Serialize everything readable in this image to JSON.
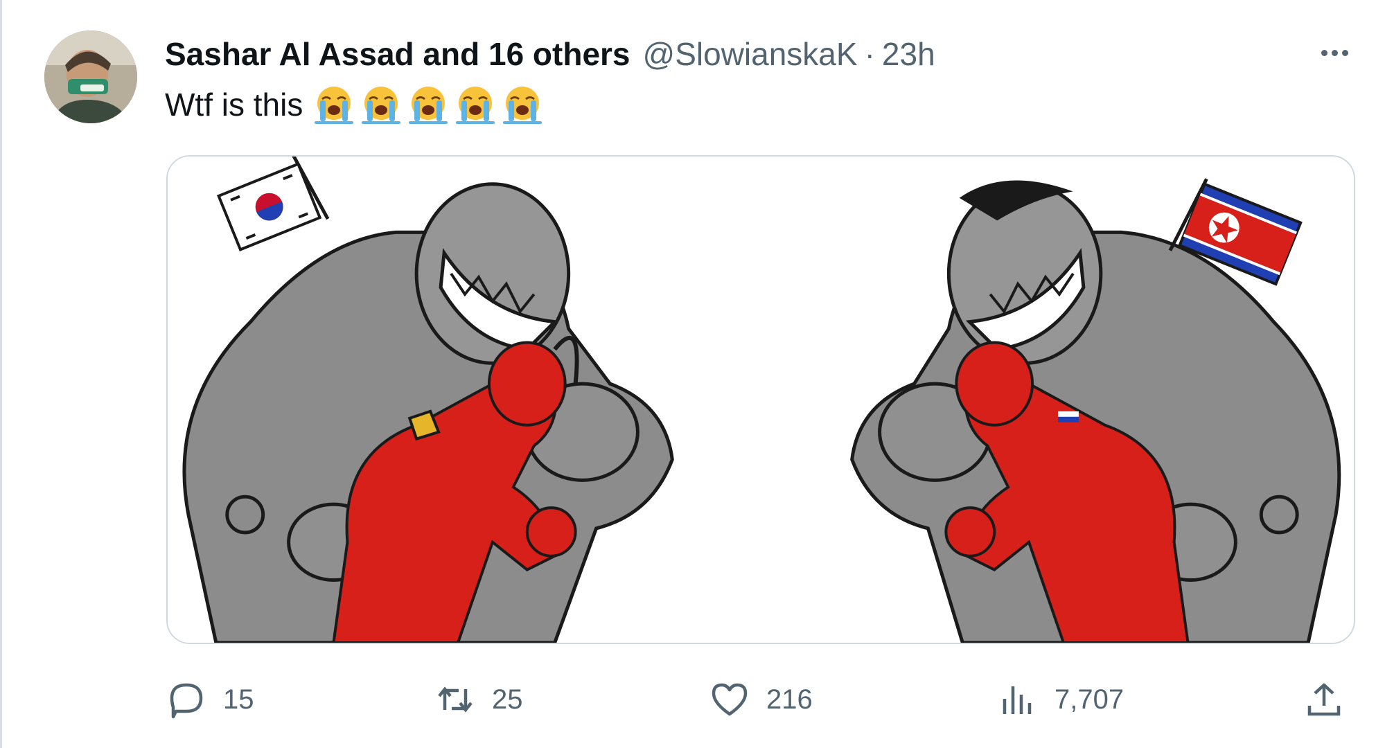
{
  "tweet": {
    "display_name": "Sashar Al Assad and 16 others",
    "handle": "@SlowianskaK",
    "separator": "·",
    "time": "23h",
    "text": "Wtf is this",
    "emojis": [
      "loudly-crying-face",
      "loudly-crying-face",
      "loudly-crying-face",
      "loudly-crying-face",
      "loudly-crying-face"
    ],
    "more_icon": "more-horizontal-icon"
  },
  "media": {
    "left_flag": "south-korea-flag",
    "right_flag": "north-korea-flag",
    "colors": {
      "giant": "#8c8c8c",
      "fighter": "#d8201a",
      "outline": "#1a1a1a"
    }
  },
  "actions": {
    "reply": {
      "icon": "reply-icon",
      "count": "15"
    },
    "retweet": {
      "icon": "retweet-icon",
      "count": "25"
    },
    "like": {
      "icon": "heart-icon",
      "count": "216"
    },
    "views": {
      "icon": "views-icon",
      "count": "7,707"
    },
    "share": {
      "icon": "share-icon"
    }
  },
  "colors": {
    "text": "#0f1419",
    "secondary": "#536471",
    "border": "#cfd9de"
  }
}
